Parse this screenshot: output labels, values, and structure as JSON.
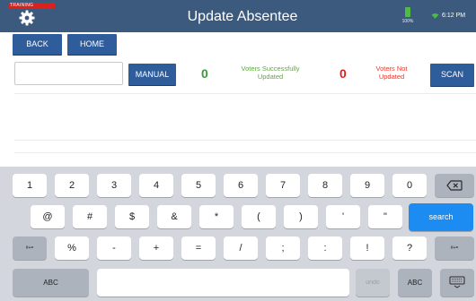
{
  "header": {
    "badge": "TRAINING",
    "title": "Update Absentee",
    "battery": "100%",
    "time": "6:12 PM"
  },
  "toolbar": {
    "back": "BACK",
    "home": "HOME"
  },
  "entry": {
    "value": "",
    "placeholder": ""
  },
  "actions": {
    "manual": "MANUAL",
    "scan": "SCAN"
  },
  "stats": {
    "success_count": "0",
    "success_label": "Voters Successfully Updated",
    "fail_count": "0",
    "fail_label": "Voters Not Updated"
  },
  "colors": {
    "header_bg": "#3c5a7e",
    "button_bg": "#2f5c9a",
    "success": "#3a9a3a",
    "fail": "#e02020",
    "search_key": "#1c8cf2"
  },
  "keyboard": {
    "row1": [
      "1",
      "2",
      "3",
      "4",
      "5",
      "6",
      "7",
      "8",
      "9",
      "0"
    ],
    "row2": [
      "@",
      "#",
      "$",
      "&",
      "*",
      "(",
      ")",
      "'",
      "\""
    ],
    "row3": [
      "%",
      "-",
      "+",
      "=",
      "/",
      ";",
      ":",
      "!",
      "?"
    ],
    "shift": "#+=",
    "search": "search",
    "abc": "ABC",
    "undo": "undo"
  }
}
